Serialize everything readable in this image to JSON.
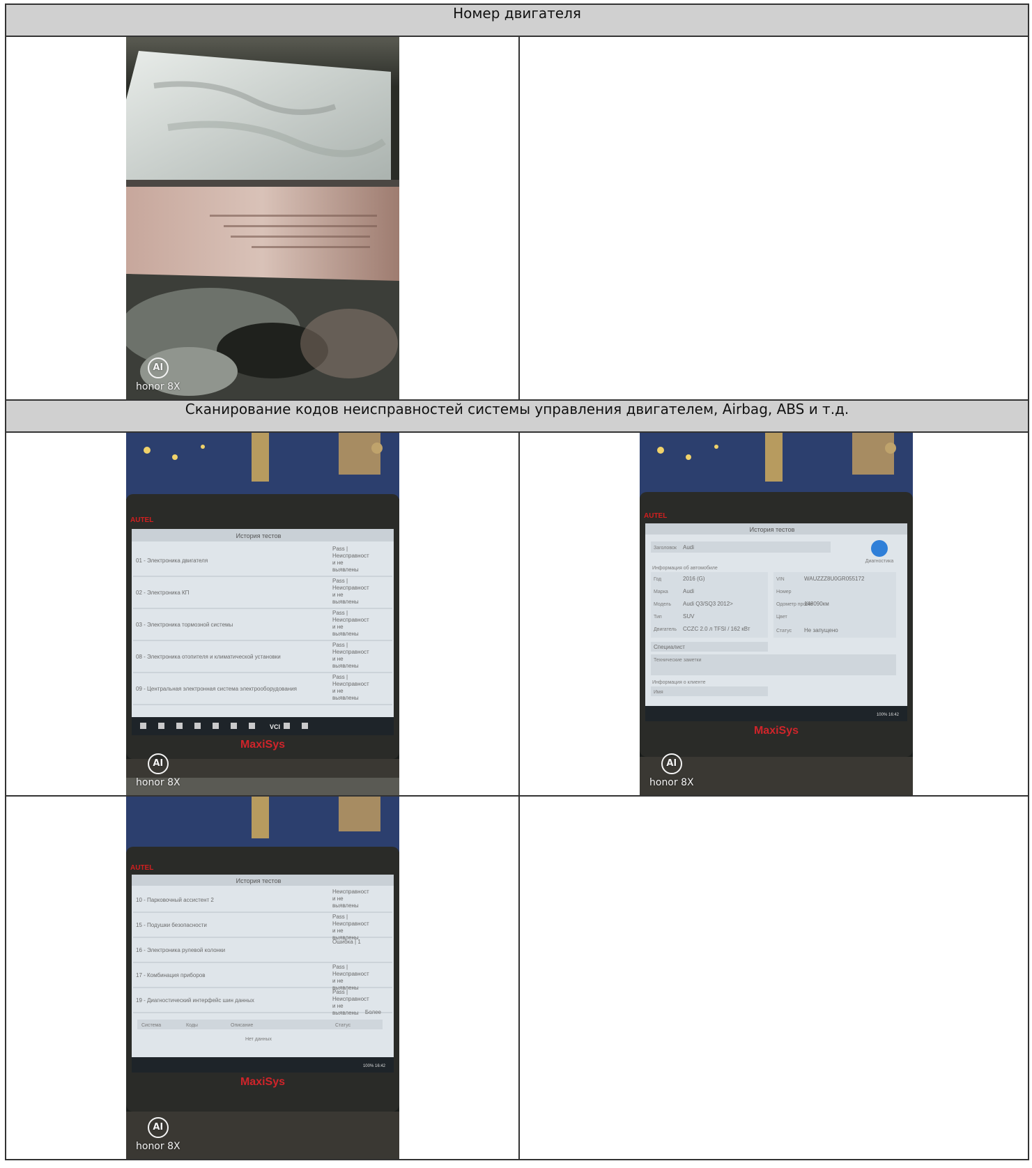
{
  "sections": {
    "engine_number": "Номер двигателя",
    "fault_scan": "Сканирование кодов неисправностей системы управления двигателем, Airbag, ABS и т.д."
  },
  "watermark": {
    "brand": "honor 8X",
    "badge": "AI"
  },
  "photos": {
    "scan_tool": {
      "maker": "AUTEL",
      "model": "MaxiSys",
      "screen_title": "История тестов",
      "list1": [
        {
          "name": "01 - Электроника двигателя",
          "status": [
            "Pass |",
            "Неисправност",
            "и не",
            "выявлены"
          ]
        },
        {
          "name": "02 - Электроника КП",
          "status": [
            "Pass |",
            "Неисправност",
            "и не",
            "выявлены"
          ]
        },
        {
          "name": "03 - Электроника тормозной системы",
          "status": [
            "Pass |",
            "Неисправност",
            "и не",
            "выявлены"
          ]
        },
        {
          "name": "08 - Электроника отопителя и климатической установки",
          "status": [
            "Pass |",
            "Неисправност",
            "и не",
            "выявлены"
          ]
        },
        {
          "name": "09 - Центральная электронная система электрооборудования",
          "status": [
            "Pass |",
            "Неисправност",
            "и не",
            "выявлены"
          ]
        }
      ],
      "list2": [
        {
          "name": "10 - Парковочный ассистент 2",
          "status": [
            "Неисправност",
            "и не",
            "выявлены"
          ]
        },
        {
          "name": "15 - Подушки безопасности",
          "status": [
            "Pass |",
            "Неисправност",
            "и не",
            "выявлены"
          ]
        },
        {
          "name": "16 - Электроника рулевой колонки",
          "status": [
            "Ошибка | 1"
          ]
        },
        {
          "name": "17 - Комбинация приборов",
          "status": [
            "Pass |",
            "Неисправност",
            "и не",
            "выявлены"
          ]
        },
        {
          "name": "19 - Диагностический интерфейс шин данных",
          "status": [
            "Pass |",
            "Неисправност",
            "и не",
            "выявлены"
          ]
        }
      ],
      "more": "Более",
      "codes_header": [
        "Система",
        "Коды",
        "Описание",
        "Статус"
      ],
      "no_data": "Нет данных",
      "vehicle": {
        "header_label": "Заголовок",
        "header_value": "Audi",
        "diag_button": "Диагностика",
        "section": "Информация об автомобиле",
        "rows": [
          {
            "k": "Год",
            "v": "2016 (G)"
          },
          {
            "k": "Марка",
            "v": "Audi"
          },
          {
            "k": "Модель",
            "v": "Audi Q3/SQ3 2012>"
          },
          {
            "k": "Тип",
            "v": "SUV"
          },
          {
            "k": "Двигатель",
            "v": "CCZC 2.0 л TFSI / 162 кВт"
          }
        ],
        "vin_label": "VIN",
        "vin": "WAUZZZ8U0GR055172",
        "number_label": "Номер",
        "odo_label": "Одометр пробег",
        "odo": "148090км",
        "color_label": "Цвет",
        "status_label": "Статус",
        "status": "Не запущено",
        "specialist": "Специалист",
        "notes": "Технические заметки",
        "client": "Информация о клиенте",
        "name": "Имя"
      },
      "statusbar": "100% 16:42"
    }
  }
}
